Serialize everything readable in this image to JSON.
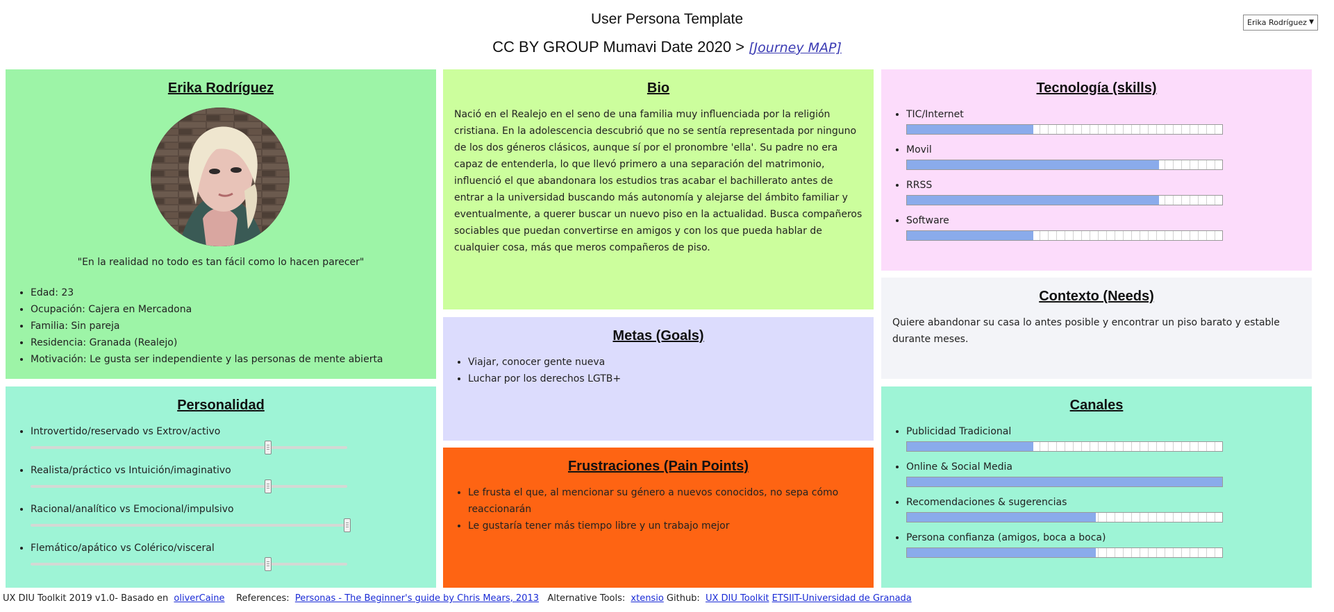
{
  "header": {
    "title": "User Persona Template",
    "subtitle": "CC BY GROUP Mumavi Date 2020 >",
    "journey_link": "[Journey MAP]"
  },
  "persona_select": {
    "value": "Erika Rodríguez"
  },
  "profile": {
    "name": "Erika Rodríguez",
    "quote": "\"En la realidad no todo es tan fácil como lo hacen parecer\"",
    "facts": [
      "Edad: 23",
      "Ocupación: Cajera en Mercadona",
      "Familia: Sin pareja",
      "Residencia: Granada (Realejo)",
      "Motivación: Le gusta ser independiente y las personas de mente abierta"
    ]
  },
  "bio": {
    "title": "Bio",
    "text": "Nació en el Realejo en el seno de una familia muy influenciada por la religión cristiana. En la adolescencia descubrió que no se sentía representada por ninguno de los dos géneros clásicos, aunque sí por el pronombre 'ella'. Su padre no era capaz de entenderla, lo que llevó primero a una separación del matrimonio, influenció el que abandonara los estudios tras acabar el bachillerato antes de entrar a la universidad buscando más autonomía y alejarse del ámbito familiar y eventualmente, a querer buscar un nuevo piso en la actualidad. Busca compañeros sociables que puedan convertirse en amigos y con los que pueda hablar de cualquier cosa, más que meros compañeros de piso."
  },
  "tech": {
    "title": "Tecnología (skills)",
    "items": [
      {
        "label": "TIC/Internet",
        "value": 0.4
      },
      {
        "label": "Movil",
        "value": 0.8
      },
      {
        "label": "RRSS",
        "value": 0.8
      },
      {
        "label": "Software",
        "value": 0.4
      }
    ]
  },
  "context": {
    "title": "Contexto (Needs)",
    "text": "Quiere abandonar su casa lo antes posible y encontrar un piso barato y estable durante meses."
  },
  "goals": {
    "title": "Metas (Goals)",
    "items": [
      "Viajar, conocer gente nueva",
      "Luchar por los derechos LGTB+"
    ]
  },
  "personality": {
    "title": "Personalidad",
    "items": [
      {
        "label": "Introvertido/reservado vs Extrov/activo",
        "value": 0.75
      },
      {
        "label": "Realista/práctico vs Intuición/imaginativo",
        "value": 0.75
      },
      {
        "label": "Racional/analítico vs Emocional/impulsivo",
        "value": 1.0
      },
      {
        "label": "Flemático/apático vs Colérico/visceral",
        "value": 0.75
      }
    ]
  },
  "channels": {
    "title": "Canales",
    "items": [
      {
        "label": "Publicidad Tradicional",
        "value": 0.4
      },
      {
        "label": "Online & Social Media",
        "value": 1.0
      },
      {
        "label": "Recomendaciones & sugerencias",
        "value": 0.6
      },
      {
        "label": "Persona confianza (amigos, boca a boca)",
        "value": 0.6
      }
    ]
  },
  "frustrations": {
    "title": "Frustraciones (Pain Points)",
    "items": [
      "Le frusta el que, al mencionar su género a nuevos conocidos, no sepa cómo reaccionarán",
      "Le gustaría tener más tiempo libre y un trabajo mejor"
    ]
  },
  "footer": {
    "credit": "UX DIU Toolkit 2019 v1.0- Basado en",
    "credit_link": "oliverCaine",
    "refs_label": "References:",
    "refs_link": "Personas - The Beginner's guide by Chris Mears, 2013",
    "alt_label": "Alternative Tools:",
    "alt_link": "xtensio",
    "github_label": "Github:",
    "github_link": "UX DIU Toolkit",
    "univ_link": "ETSIIT-Universidad de Granada"
  },
  "colors": {
    "profile": "#9df4a7",
    "bio": "#ccfe9d",
    "tech": "#fcdcfb",
    "context": "#f3f4f8",
    "goals": "#dcdcfd",
    "personality": "#9ef4d6",
    "channels": "#9ef4d6",
    "frustrations": "#fe6413",
    "bar_fill": "#8aabeb"
  }
}
